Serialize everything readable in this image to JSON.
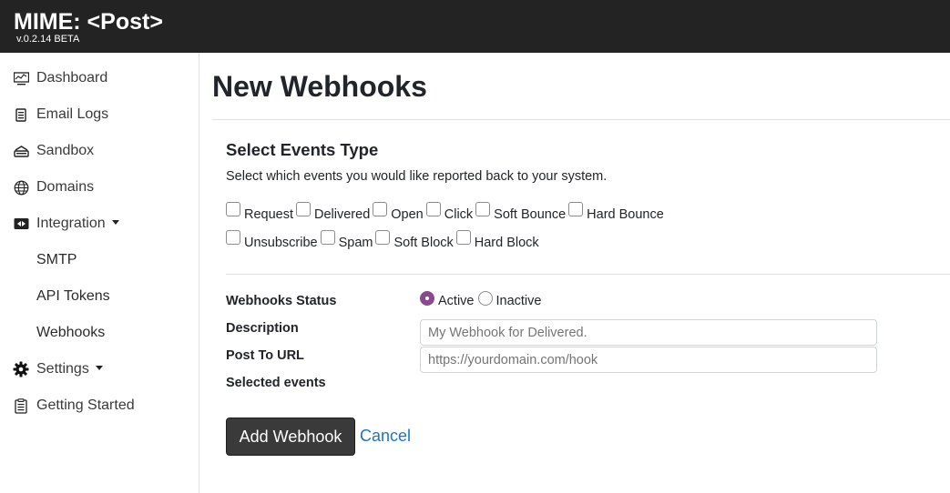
{
  "header": {
    "brand": "MIME: <Post>",
    "version": "v.0.2.14 BETA"
  },
  "sidebar": {
    "items": [
      {
        "label": "Dashboard",
        "icon": "monitor-icon"
      },
      {
        "label": "Email Logs",
        "icon": "logs-icon"
      },
      {
        "label": "Sandbox",
        "icon": "sandbox-icon"
      },
      {
        "label": "Domains",
        "icon": "globe-icon"
      },
      {
        "label": "Integration",
        "icon": "integration-icon"
      },
      {
        "label": "SMTP"
      },
      {
        "label": "API Tokens"
      },
      {
        "label": "Webhooks"
      },
      {
        "label": "Settings",
        "icon": "gear-icon"
      },
      {
        "label": "Getting Started",
        "icon": "clipboard-icon"
      }
    ]
  },
  "main": {
    "title": "New Webhooks",
    "events_section": {
      "title": "Select Events Type",
      "subtitle": "Select which events you would like reported back to your system.",
      "row1": [
        "Request",
        "Delivered",
        "Open",
        "Click",
        "Soft Bounce",
        "Hard Bounce"
      ],
      "row2": [
        "Unsubscribe",
        "Spam",
        "Soft Block",
        "Hard Block"
      ]
    },
    "form": {
      "status_label": "Webhooks Status",
      "status_options": [
        "Active",
        "Inactive"
      ],
      "status_selected": "Active",
      "description_label": "Description",
      "description_placeholder": "My Webhook for Delivered.",
      "url_label": "Post To URL",
      "url_placeholder": "https://yourdomain.com/hook",
      "selected_events_label": "Selected events"
    },
    "actions": {
      "add_label": "Add Webhook",
      "cancel_label": "Cancel"
    }
  },
  "colors": {
    "topbar": "#232323",
    "radio_accent": "#8b4a8f",
    "link": "#1b73d3",
    "button": "#3a3a3a"
  }
}
